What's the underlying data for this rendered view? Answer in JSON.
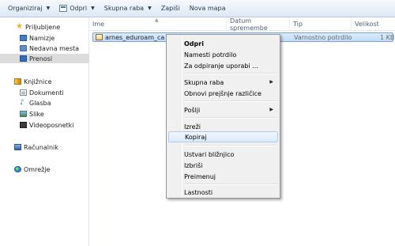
{
  "toolbar": {
    "organize": "Organiziraj",
    "open": "Odpri",
    "share": "Skupna raba",
    "burn": "Zapiši",
    "new_folder": "Nova mapa"
  },
  "nav": {
    "favorites": "Priljubljene",
    "desktop": "Namizje",
    "recent": "Nedavna mesta",
    "downloads": "Prenosi",
    "libraries": "Knjižnice",
    "documents": "Dokumenti",
    "music": "Glasba",
    "pictures": "Slike",
    "videos": "Videoposnetki",
    "computer": "Računalnik",
    "network": "Omrežje"
  },
  "columns": {
    "name": "Ime",
    "date": "Datum spremembe",
    "type": "Tip",
    "size": "Velikost"
  },
  "file": {
    "name": "arnes_eduroam_ca",
    "type": "Varnostno potrdilo",
    "size": "1 KB"
  },
  "context_menu": {
    "open": "Odpri",
    "install_cert": "Namesti potrdilo",
    "open_with": "Za odpiranje uporabi ...",
    "share_with": "Skupna raba",
    "restore": "Obnovi prejšnje različice",
    "send_to": "Pošlji",
    "cut": "Izreži",
    "copy": "Kopiraj",
    "create_shortcut": "Ustvari bližnjico",
    "delete": "Izbriši",
    "rename": "Preimenuj",
    "properties": "Lastnosti"
  },
  "colors": {
    "selection": "#c1dcfc",
    "menu_highlight": "#dde9f8"
  }
}
